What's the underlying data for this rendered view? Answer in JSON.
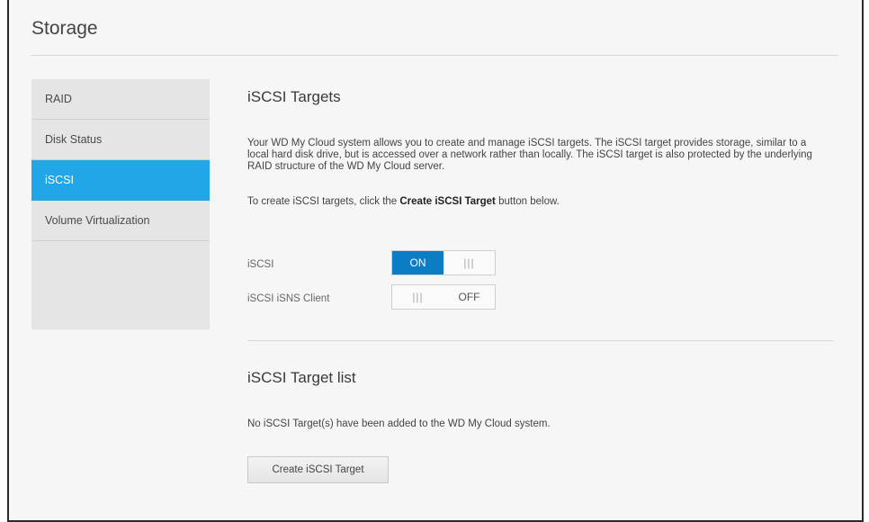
{
  "page_title": "Storage",
  "sidebar": {
    "items": [
      {
        "label": "RAID",
        "active": false
      },
      {
        "label": "Disk Status",
        "active": false
      },
      {
        "label": "iSCSI",
        "active": true
      },
      {
        "label": "Volume Virtualization",
        "active": false
      }
    ]
  },
  "targets_section": {
    "heading": "iSCSI Targets",
    "description": "Your WD My Cloud system allows you to create and manage iSCSI targets. The iSCSI target provides storage, similar to a local hard disk drive, but is accessed over a network rather than locally. The iSCSI target is also protected by the underlying RAID structure of the WD My Cloud server.",
    "instruction_prefix": "To create iSCSI targets, click the ",
    "instruction_bold": "Create iSCSI Target",
    "instruction_suffix": " button below."
  },
  "settings": {
    "iscsi": {
      "label": "iSCSI",
      "state": "ON",
      "on_text": "ON"
    },
    "isns": {
      "label": "iSCSI iSNS Client",
      "state": "OFF",
      "off_text": "OFF"
    }
  },
  "target_list": {
    "heading": "iSCSI Target list",
    "empty_message": "No iSCSI Target(s) have been added to the WD My Cloud system.",
    "create_button": "Create iSCSI Target"
  },
  "colors": {
    "accent": "#21a7e8",
    "toggle_on": "#0b7dc5",
    "sidebar_bg": "#e5e5e5",
    "page_bg": "#f6f6f6"
  }
}
